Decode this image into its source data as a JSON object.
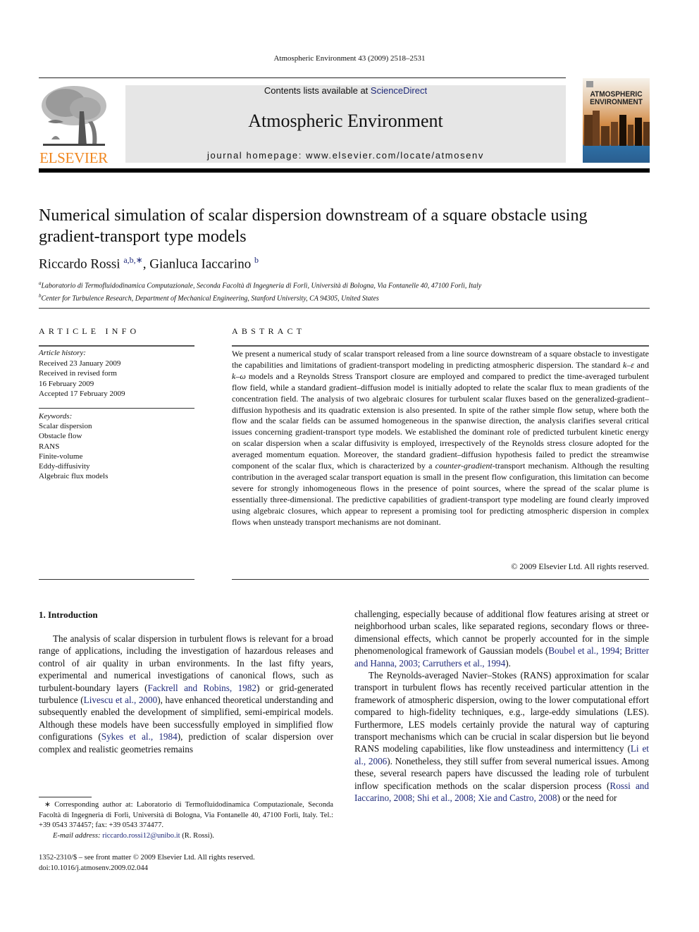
{
  "header": {
    "running_head": "Atmospheric Environment 43 (2009) 2518–2531",
    "contents_prefix": "Contents lists available at ",
    "contents_link": "ScienceDirect",
    "journal_name": "Atmospheric Environment",
    "homepage": "journal homepage: www.elsevier.com/locate/atmosenv",
    "publisher_logo_text": "ELSEVIER",
    "cover_title_line1": "ATMOSPHERIC",
    "cover_title_line2": "ENVIRONMENT",
    "colors": {
      "publisher_orange": "#f0861e",
      "link_blue": "#1f2a7a",
      "banner_gray": "#e6e6e6"
    }
  },
  "article": {
    "title": "Numerical simulation of scalar dispersion downstream of a square obstacle using gradient-transport type models",
    "authors": [
      {
        "name": "Riccardo Rossi",
        "marks": "a,b,∗"
      },
      {
        "name": "Gianluca Iaccarino",
        "marks": "b"
      }
    ],
    "author_separator": ", ",
    "affiliations": [
      {
        "mark": "a",
        "text": "Laboratorio di Termofluidodinamica Computazionale, Seconda Facoltà di Ingegneria di Forlì, Università di Bologna, Via Fontanelle 40, 47100 Forlì, Italy"
      },
      {
        "mark": "b",
        "text": "Center for Turbulence Research, Department of Mechanical Engineering, Stanford University, CA 94305, United States"
      }
    ]
  },
  "article_info": {
    "heading": "ARTICLE INFO",
    "history_label": "Article history:",
    "history": [
      "Received 23 January 2009",
      "Received in revised form",
      "16 February 2009",
      "Accepted 17 February 2009"
    ],
    "keywords_label": "Keywords:",
    "keywords": [
      "Scalar dispersion",
      "Obstacle flow",
      "RANS",
      "Finite-volume",
      "Eddy-diffusivity",
      "Algebraic flux models"
    ]
  },
  "abstract": {
    "heading": "ABSTRACT",
    "part1": "We present a numerical study of scalar transport released from a line source downstream of a square obstacle to investigate the capabilities and limitations of gradient-transport modeling in predicting atmospheric dispersion. The standard ",
    "k_eps": "k–ε",
    "part2": " and ",
    "k_omega": "k–ω",
    "part3": " models and a Reynolds Stress Transport closure are employed and compared to predict the time-averaged turbulent flow field, while a standard gradient–diffusion model is initially adopted to relate the scalar flux to mean gradients of the concentration field. The analysis of two algebraic closures for turbulent scalar fluxes based on the generalized-gradient–diffusion hypothesis and its quadratic extension is also presented. In spite of the rather simple flow setup, where both the flow and the scalar fields can be assumed homogeneous in the spanwise direction, the analysis clarifies several critical issues concerning gradient-transport type models. We established the dominant role of predicted turbulent kinetic energy on scalar dispersion when a scalar diffusivity is employed, irrespectively of the Reynolds stress closure adopted for the averaged momentum equation. Moreover, the standard gradient–diffusion hypothesis failed to predict the streamwise component of the scalar flux, which is characterized by a ",
    "counter_gradient": "counter-gradient",
    "part4": "-transport mechanism. Although the resulting contribution in the averaged scalar transport equation is small in the present flow configuration, this limitation can become severe for strongly inhomogeneous flows in the presence of point sources, where the spread of the scalar plume is essentially three-dimensional. The predictive capabilities of gradient-transport type modeling are found clearly improved using algebraic closures, which appear to represent a promising tool for predicting atmospheric dispersion in complex flows when unsteady transport mechanisms are not dominant.",
    "copyright": "© 2009 Elsevier Ltd. All rights reserved."
  },
  "introduction": {
    "heading": "1.  Introduction",
    "left": {
      "t1": "The analysis of scalar dispersion in turbulent flows is relevant for a broad range of applications, including the investigation of hazardous releases and control of air quality in urban environments. In the last fifty years, experimental and numerical investigations of canonical flows, such as turbulent-boundary layers (",
      "c1": "Fackrell and Robins, 1982",
      "t2": ") or grid-generated turbulence (",
      "c2": "Livescu et al., 2000",
      "t3": "), have enhanced theoretical understanding and subsequently enabled the development of simplified, semi-empirical models. Although these models have been successfully employed in simplified flow configurations (",
      "c3": "Sykes et al., 1984",
      "t4": "), prediction of scalar dispersion over complex and realistic geometries remains"
    },
    "right": {
      "t1": "challenging, especially because of additional flow features arising at street or neighborhood urban scales, like separated regions, secondary flows or three-dimensional effects, which cannot be properly accounted for in the simple phenomenological framework of Gaussian models (",
      "c1": "Boubel et al., 1994; Britter and Hanna, 2003; Carruthers et al., 1994",
      "t2": ").",
      "p2_t1": "The Reynolds-averaged Navier–Stokes (RANS) approximation for scalar transport in turbulent flows has recently received particular attention in the framework of atmospheric dispersion, owing to the lower computational effort compared to high-fidelity techniques, e.g., large-eddy simulations (LES). Furthermore, LES models certainly provide the natural way of capturing transport mechanisms which can be crucial in scalar dispersion but lie beyond RANS modeling capabilities, like flow unsteadiness and intermittency (",
      "p2_c1": "Li et al., 2006",
      "p2_t2": "). Nonetheless, they still suffer from several numerical issues. Among these, several research papers have discussed the leading role of turbulent inflow specification methods on the scalar dispersion process (",
      "p2_c2": "Rossi and Iaccarino, 2008; Shi et al., 2008; Xie and Castro, 2008",
      "p2_t3": ") or the need for"
    }
  },
  "footnote": {
    "corresponding": "∗ Corresponding author at: Laboratorio di Termofluidodinamica Computazionale, Seconda Facoltà di Ingegneria di Forlì, Università di Bologna, Via Fontanelle 40, 47100 Forlì, Italy. Tel.: +39 0543 374457; fax: +39 0543 374477.",
    "email_label": "E-mail address:",
    "email": "riccardo.rossi12@unibo.it",
    "email_suffix": " (R. Rossi).",
    "issn_line": "1352-2310/$ – see front matter © 2009 Elsevier Ltd. All rights reserved.",
    "doi": "doi:10.1016/j.atmosenv.2009.02.044"
  }
}
